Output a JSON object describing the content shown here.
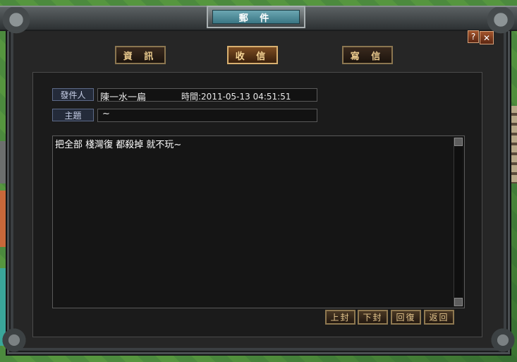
{
  "window": {
    "title": "郵 件"
  },
  "controls": {
    "help": "?",
    "close": "✕"
  },
  "tabs": [
    {
      "label": "資 訊",
      "active": false
    },
    {
      "label": "收 信",
      "active": true
    },
    {
      "label": "寫 信",
      "active": false
    }
  ],
  "mail": {
    "sender_label": "發件人",
    "sender": "陳一水一扁",
    "time": "時間:2011-05-13 04:51:51",
    "subject_label": "主題",
    "subject": "~",
    "body": "把全部 棧灣復 都殺掉 就不玩~"
  },
  "actions": {
    "prev": "上封",
    "next": "下封",
    "reply": "回復",
    "back": "返回"
  },
  "icons": {
    "help": "help-icon",
    "close": "close-icon",
    "scroll_up": "scroll-up-icon",
    "scroll_down": "scroll-down-icon"
  }
}
